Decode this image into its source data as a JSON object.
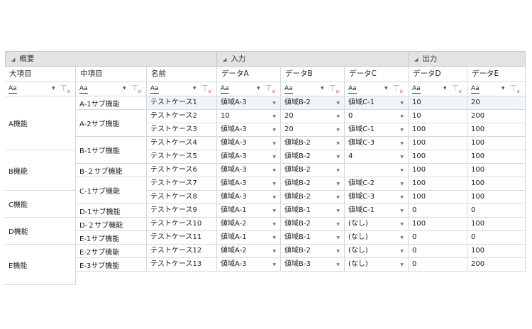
{
  "groups": [
    {
      "label": "概要"
    },
    {
      "label": "入力"
    },
    {
      "label": "出力"
    }
  ],
  "columns": [
    "大項目",
    "中項目",
    "名前",
    "データA",
    "データB",
    "データC",
    "データD",
    "データE"
  ],
  "filter_icon_text": "Aa",
  "major_items": [
    "A機能",
    "B機能",
    "C機能",
    "D機能",
    "E機能"
  ],
  "mid_items": [
    "A-1サブ機能",
    "A-2サブ機能",
    "B-1サブ機能",
    "B-２サブ機能",
    "C-1サブ機能",
    "D-1サブ機能",
    "D-２サブ機能",
    "E-1サブ機能",
    "E-2サブ機能",
    "E-3サブ機能"
  ],
  "rows": [
    {
      "name": "テストケース1",
      "a": "値域A-3",
      "b": "値域B-2",
      "c": "値域C-1",
      "d": "10",
      "e": "20"
    },
    {
      "name": "テストケース2",
      "a": "10",
      "b": "20",
      "c": "0",
      "d": "10",
      "e": "200"
    },
    {
      "name": "テストケース3",
      "a": "値域A-3",
      "b": "20",
      "c": "値域C-1",
      "d": "100",
      "e": "100"
    },
    {
      "name": "テストケース4",
      "a": "値域A-3",
      "b": "値域B-2",
      "c": "値域C-3",
      "d": "100",
      "e": "100"
    },
    {
      "name": "テストケース5",
      "a": "値域A-3",
      "b": "値域B-2",
      "c": "4",
      "d": "100",
      "e": "100"
    },
    {
      "name": "テストケース6",
      "a": "値域A-3",
      "b": "値域B-2",
      "c": "",
      "d": "100",
      "e": "100"
    },
    {
      "name": "テストケース7",
      "a": "値域A-3",
      "b": "値域B-2",
      "c": "値域C-2",
      "d": "100",
      "e": "100"
    },
    {
      "name": "テストケース8",
      "a": "値域A-3",
      "b": "値域B-2",
      "c": "値域C-3",
      "d": "100",
      "e": "100"
    },
    {
      "name": "テストケース9",
      "a": "値域A-1",
      "b": "値域B-1",
      "c": "値域C-1",
      "d": "0",
      "e": "0"
    },
    {
      "name": "テストケース10",
      "a": "値域A-2",
      "b": "値域B-2",
      "c": "(なし)",
      "d": "100",
      "e": "100"
    },
    {
      "name": "テストケース11",
      "a": "値域A-1",
      "b": "値域B-1",
      "c": "(なし)",
      "d": "0",
      "e": "0"
    },
    {
      "name": "テストケース12",
      "a": "値域A-2",
      "b": "値域B-2",
      "c": "(なし)",
      "d": "0",
      "e": "100"
    },
    {
      "name": "テストケース13",
      "a": "値域A-3",
      "b": "値域B-3",
      "c": "(なし)",
      "d": "0",
      "e": "200"
    }
  ],
  "colors": {
    "group_bg": "#e3e3e3",
    "border": "#d9d9d9",
    "selected_row": "#eef6fb"
  }
}
